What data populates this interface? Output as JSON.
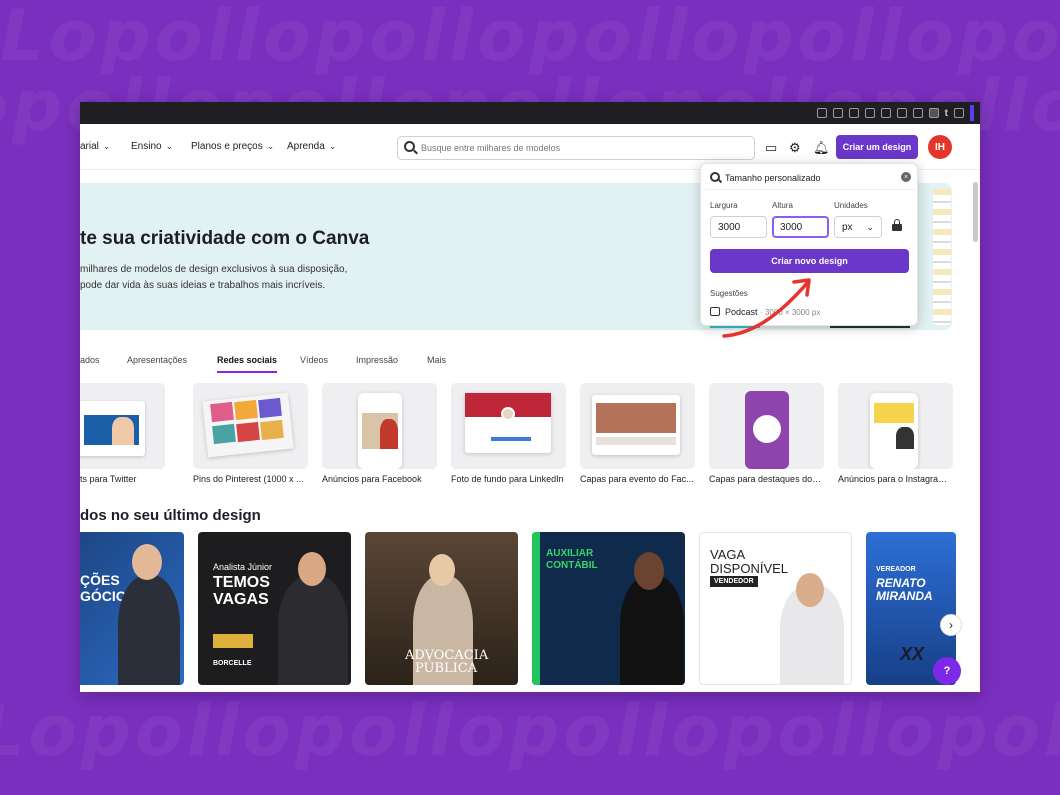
{
  "browser": {
    "toolbar_letter": "t"
  },
  "nav": {
    "items": [
      {
        "label": "arial"
      },
      {
        "label": "Ensino"
      },
      {
        "label": "Planos e preços"
      },
      {
        "label": "Aprenda"
      }
    ],
    "search_placeholder": "Busque entre milhares de modelos",
    "create_button": "Criar um design",
    "avatar_initials": "IH"
  },
  "hero": {
    "title": "te sua criatividade com o Canva",
    "subtitle_line1": "milhares de modelos de design exclusivos à sua disposição,",
    "subtitle_line2": "pode dar vida às suas ideias e trabalhos mais incríveis."
  },
  "tabs": [
    {
      "label": "ados"
    },
    {
      "label": "Apresentações"
    },
    {
      "label": "Redes sociais",
      "active": true
    },
    {
      "label": "Vídeos"
    },
    {
      "label": "Impressão"
    },
    {
      "label": "Mais"
    }
  ],
  "template_cards": [
    {
      "label": "ts para Twitter"
    },
    {
      "label": "Pins do Pinterest (1000 x ..."
    },
    {
      "label": "Anúncios para Facebook"
    },
    {
      "label": "Foto de fundo para LinkedIn"
    },
    {
      "label": "Capas para evento do Fac..."
    },
    {
      "label": "Capas para destaques dos ..."
    },
    {
      "label": "Anúncios para o Instagram..."
    }
  ],
  "section_title": "dos no seu último design",
  "designs": [
    {
      "lines": [
        "ÇÕES",
        "GÓCIOS"
      ]
    },
    {
      "lines": [
        "Analista Júnior",
        "TEMOS",
        "VAGAS",
        "BORCELLE"
      ]
    },
    {
      "lines": [
        "ADVOCACIA",
        "PÚBLICA"
      ]
    },
    {
      "lines": [
        "AUXILIAR",
        "CONTÁBIL"
      ]
    },
    {
      "lines": [
        "VAGA",
        "DISPONÍVEL",
        "VENDEDOR"
      ]
    },
    {
      "lines": [
        "VEREADOR",
        "RENATO",
        "MIRANDA",
        "XX"
      ]
    }
  ],
  "popup": {
    "search_value": "Tamanho personalizado",
    "width_label": "Largura",
    "height_label": "Altura",
    "units_label": "Unidades",
    "width_value": "3000",
    "height_value": "3000",
    "unit_value": "px",
    "submit": "Criar novo design",
    "suggestions_label": "Sugestões",
    "suggestion_name": "Podcast",
    "suggestion_dims": "· 3000 × 3000 px"
  },
  "help_label": "?",
  "colors": {
    "accent": "#6a37c8",
    "avatar": "#e3352c",
    "background": "#7b2fbf",
    "highlight": "#7d2ae8"
  }
}
